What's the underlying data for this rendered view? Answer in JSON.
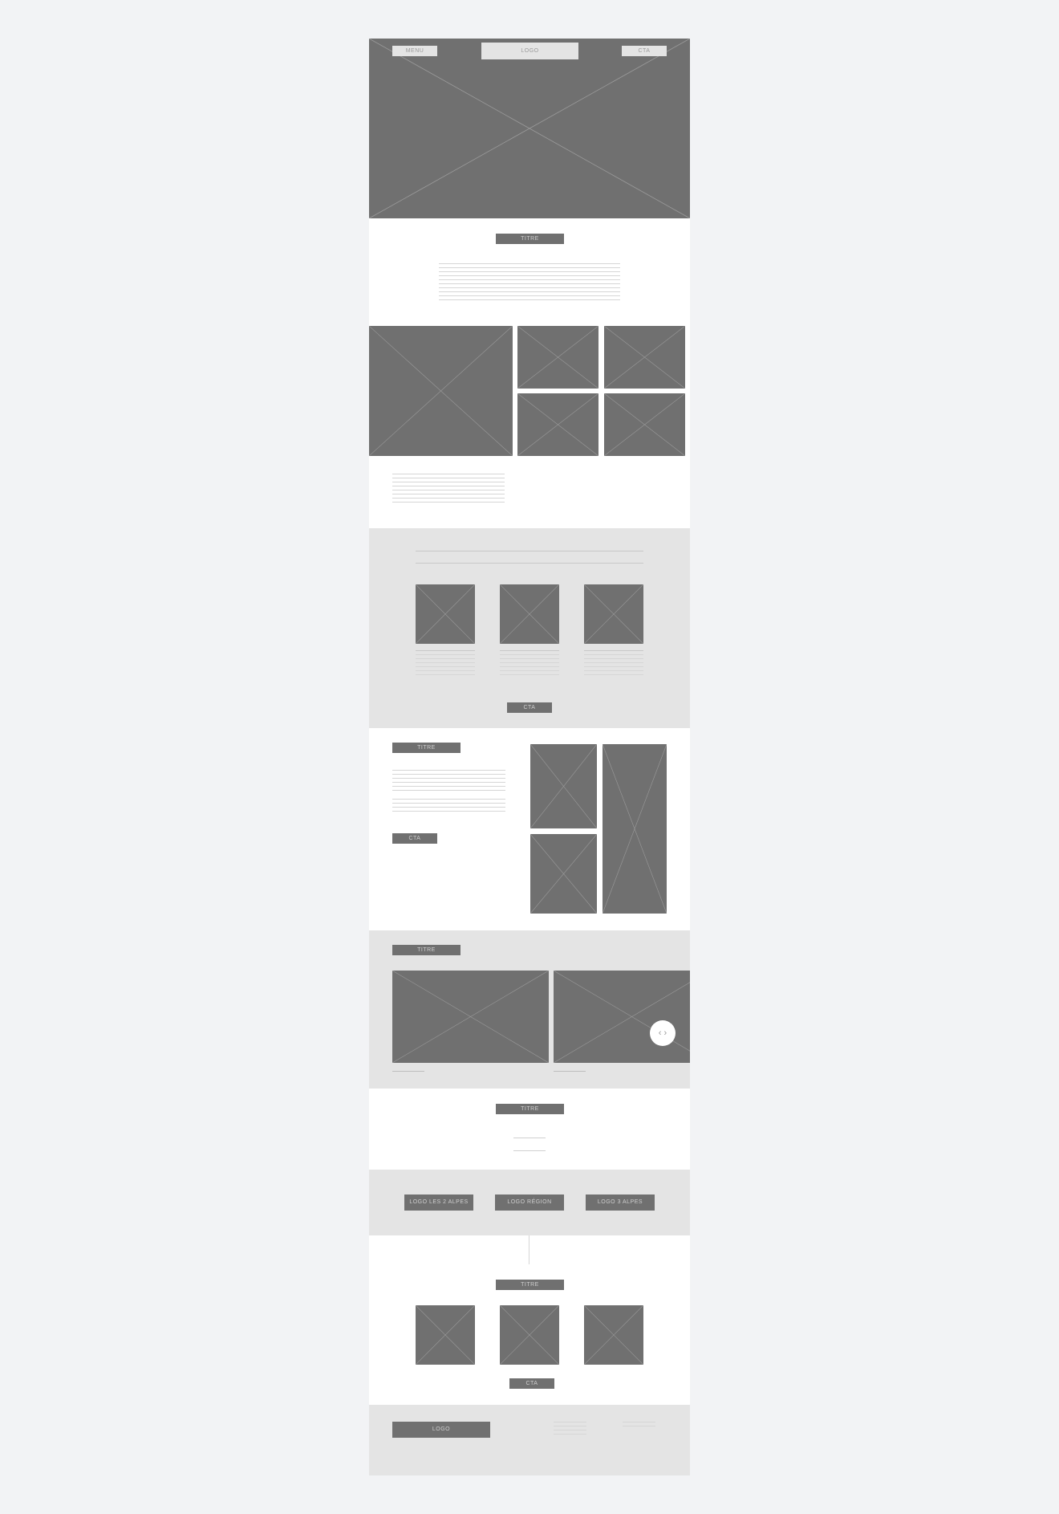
{
  "header": {
    "menu_label": "MENU",
    "logo_label": "LOGO",
    "cta_label": "CTA"
  },
  "intro": {
    "title": "TITRE"
  },
  "features": {
    "cta_label": "CTA"
  },
  "split": {
    "title": "TITRE",
    "cta_label": "CTA"
  },
  "carousel": {
    "title": "TITRE",
    "nav_icon": "chevron-left-right-icon",
    "nav_glyph": "‹ ›"
  },
  "section_title": {
    "title": "TITRE"
  },
  "partners": {
    "logos": [
      "LOGO LES 2 ALPES",
      "LOGO RÉGION",
      "LOGO 3 ALPES"
    ]
  },
  "gallery": {
    "title": "TITRE",
    "cta_label": "CTA"
  },
  "footer": {
    "logo_label": "LOGO"
  },
  "colors": {
    "placeholder": "#707070",
    "grey_section": "#e4e4e4",
    "background": "#f2f3f5"
  }
}
